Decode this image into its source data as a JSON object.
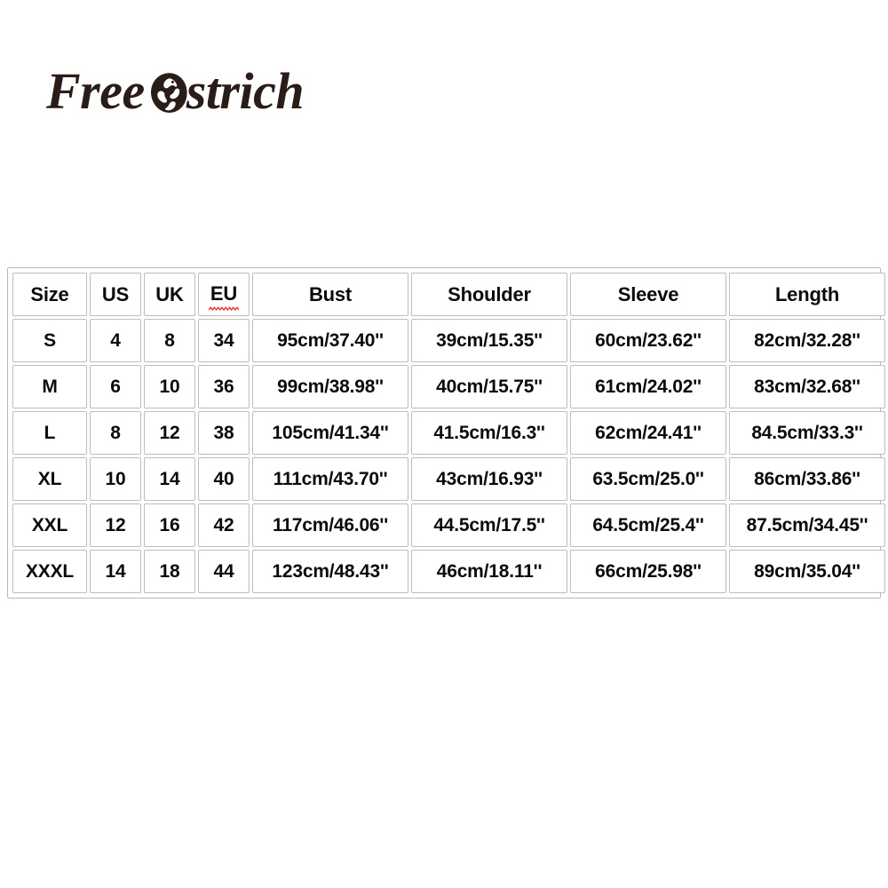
{
  "brand": {
    "name_before_mark": "Free",
    "mark_letter": "O",
    "name_after_mark": "strich",
    "full_name": "Free Ostrich",
    "logo_color": "#2a1d18",
    "mark_icon": "ostrich-icon"
  },
  "size_chart": {
    "columns": [
      "Size",
      "US",
      "UK",
      "EU",
      "Bust",
      "Shoulder",
      "Sleeve",
      "Length"
    ],
    "misspelled_column": "EU",
    "squiggle_color": "#e8262a",
    "border_color": "#bdbdbd",
    "text_color": "#0b0b0b",
    "rows": [
      {
        "size": "S",
        "us": "4",
        "uk": "8",
        "eu": "34",
        "bust": "95cm/37.40''",
        "shoulder": "39cm/15.35''",
        "sleeve": "60cm/23.62''",
        "length": "82cm/32.28''"
      },
      {
        "size": "M",
        "us": "6",
        "uk": "10",
        "eu": "36",
        "bust": "99cm/38.98''",
        "shoulder": "40cm/15.75''",
        "sleeve": "61cm/24.02''",
        "length": "83cm/32.68''"
      },
      {
        "size": "L",
        "us": "8",
        "uk": "12",
        "eu": "38",
        "bust": "105cm/41.34''",
        "shoulder": "41.5cm/16.3''",
        "sleeve": "62cm/24.41''",
        "length": "84.5cm/33.3''"
      },
      {
        "size": "XL",
        "us": "10",
        "uk": "14",
        "eu": "40",
        "bust": "111cm/43.70''",
        "shoulder": "43cm/16.93''",
        "sleeve": "63.5cm/25.0''",
        "length": "86cm/33.86''"
      },
      {
        "size": "XXL",
        "us": "12",
        "uk": "16",
        "eu": "42",
        "bust": "117cm/46.06''",
        "shoulder": "44.5cm/17.5''",
        "sleeve": "64.5cm/25.4''",
        "length": "87.5cm/34.45''"
      },
      {
        "size": "XXXL",
        "us": "14",
        "uk": "18",
        "eu": "44",
        "bust": "123cm/48.43''",
        "shoulder": "46cm/18.11''",
        "sleeve": "66cm/25.98''",
        "length": "89cm/35.04''"
      }
    ]
  }
}
